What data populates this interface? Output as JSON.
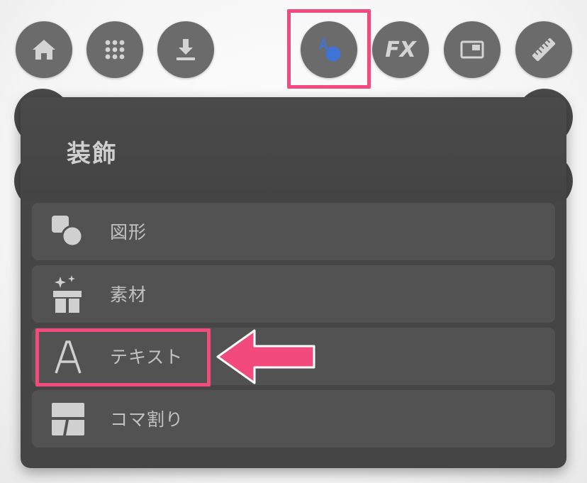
{
  "toolbar": {
    "buttons": [
      {
        "icon": "home-icon"
      },
      {
        "icon": "grid-icon"
      },
      {
        "icon": "download-icon"
      },
      {
        "icon": "decoration-icon",
        "selected": true
      },
      {
        "icon": "fx-icon",
        "label": "FX"
      },
      {
        "icon": "frame-icon"
      },
      {
        "icon": "ruler-icon"
      }
    ]
  },
  "panel": {
    "title": "装飾",
    "items": [
      {
        "label": "図形",
        "icon": "shape-icon"
      },
      {
        "label": "素材",
        "icon": "material-gift-icon"
      },
      {
        "label": "テキスト",
        "icon": "text-a-icon",
        "highlighted": true
      },
      {
        "label": "コマ割り",
        "icon": "panel-split-icon"
      }
    ]
  },
  "colors": {
    "highlight": "#f24a7c",
    "button_bg": "#6b6b6b",
    "panel_bg": "#454545",
    "item_bg": "#525252",
    "accent_blue": "#3f74d6"
  }
}
